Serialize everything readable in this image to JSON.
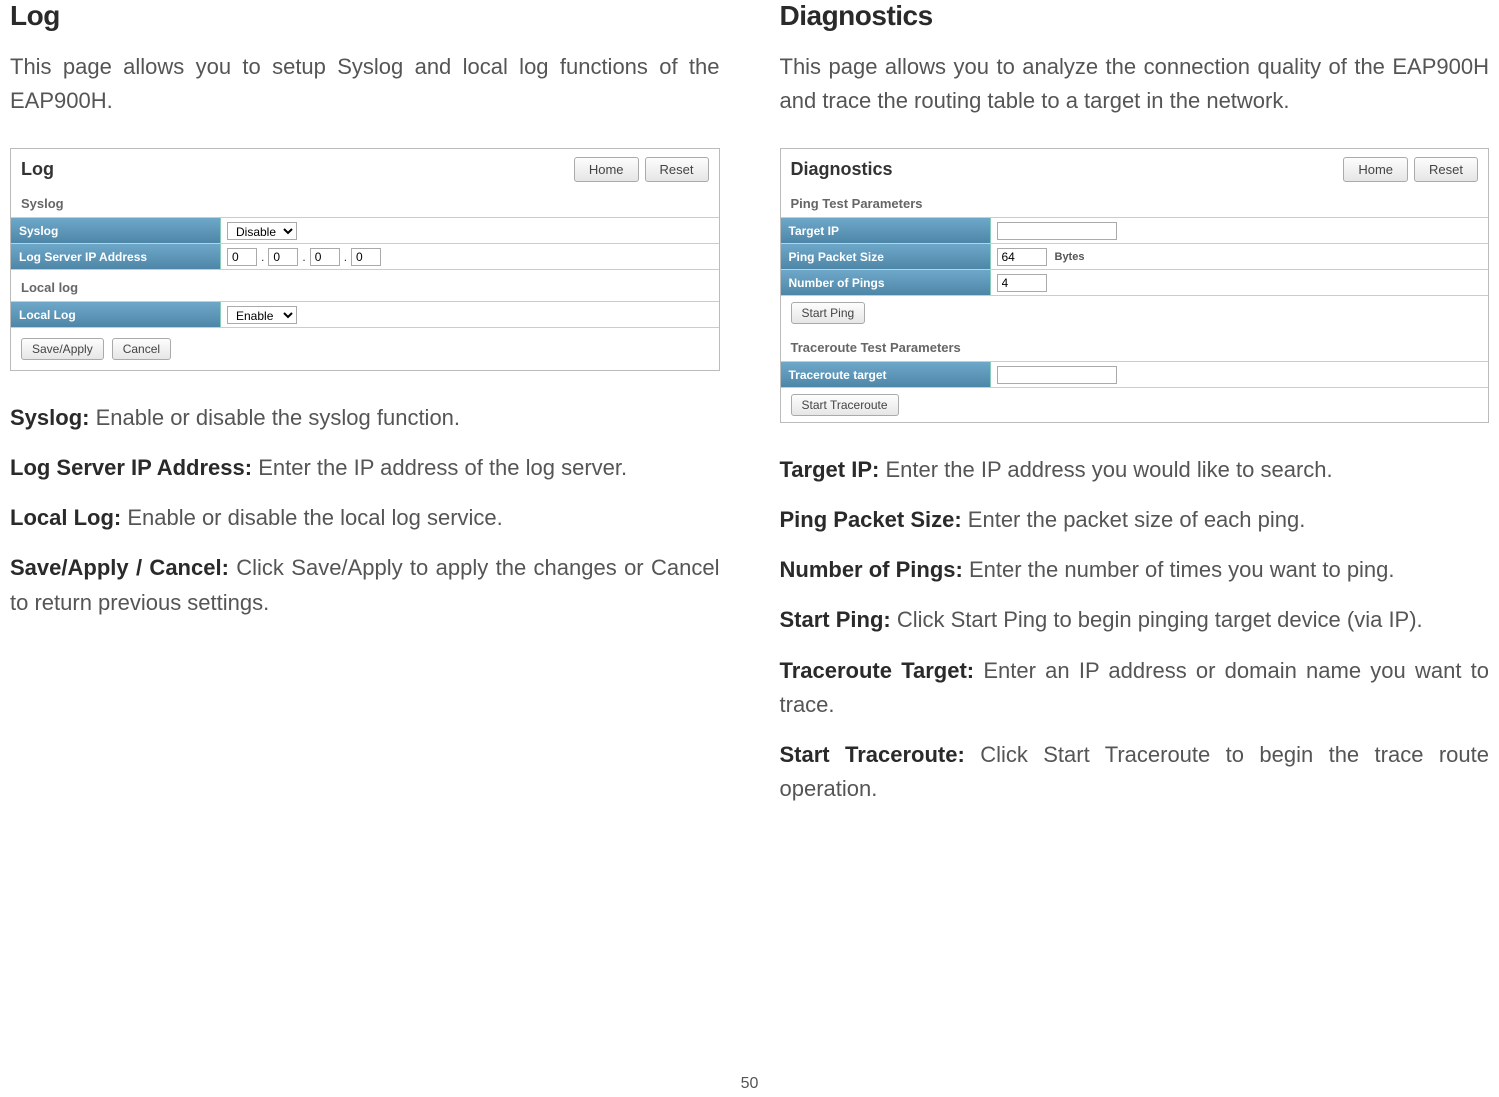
{
  "leftCol": {
    "title": "Log",
    "intro": "This page allows you to setup Syslog and local log functions of the EAP900H.",
    "panel": {
      "title": "Log",
      "homeBtn": "Home",
      "resetBtn": "Reset",
      "group_syslog": "Syslog",
      "syslog_label": "Syslog",
      "syslog_value": "Disable",
      "logserver_label": "Log Server IP Address",
      "ip0": "0",
      "ip1": "0",
      "ip2": "0",
      "ip3": "0",
      "group_local": "Local log",
      "locallog_label": "Local Log",
      "locallog_value": "Enable",
      "saveBtn": "Save/Apply",
      "cancelBtn": "Cancel"
    },
    "defs": [
      {
        "b": "Syslog:",
        "t": " Enable or disable the syslog function."
      },
      {
        "b": "Log Server IP Address:",
        "t": " Enter the IP address of the log server."
      },
      {
        "b": "Local Log:",
        "t": " Enable or disable the local log service."
      },
      {
        "b": "Save/Apply / Cancel:",
        "t": " Click Save/Apply to apply the changes or Cancel to return previous settings."
      }
    ]
  },
  "rightCol": {
    "title": "Diagnostics",
    "intro": "This page allows you to analyze the connection quality of the EAP900H and trace the routing table to a target in the network.",
    "panel": {
      "title": "Diagnostics",
      "homeBtn": "Home",
      "resetBtn": "Reset",
      "group_ping": "Ping Test Parameters",
      "targetip_label": "Target IP",
      "targetip_value": "",
      "pps_label": "Ping Packet Size",
      "pps_value": "64",
      "pps_unit": "Bytes",
      "nop_label": "Number of Pings",
      "nop_value": "4",
      "startPing": "Start Ping",
      "group_trace": "Traceroute Test Parameters",
      "trace_label": "Traceroute target",
      "trace_value": "",
      "startTrace": "Start Traceroute"
    },
    "defs": [
      {
        "b": "Target IP:",
        "t": " Enter the IP address you would like to search."
      },
      {
        "b": "Ping Packet Size:",
        "t": " Enter the packet size of each ping."
      },
      {
        "b": "Number of Pings:",
        "t": " Enter the number of times you want to ping."
      },
      {
        "b": "Start Ping:",
        "t": " Click Start Ping to begin pinging target device (via IP)."
      },
      {
        "b": "Traceroute Target:",
        "t": " Enter an IP address or domain name you want to trace."
      },
      {
        "b": "Start Traceroute:",
        "t": " Click Start Traceroute to begin the trace route operation."
      }
    ]
  },
  "pageNum": "50"
}
